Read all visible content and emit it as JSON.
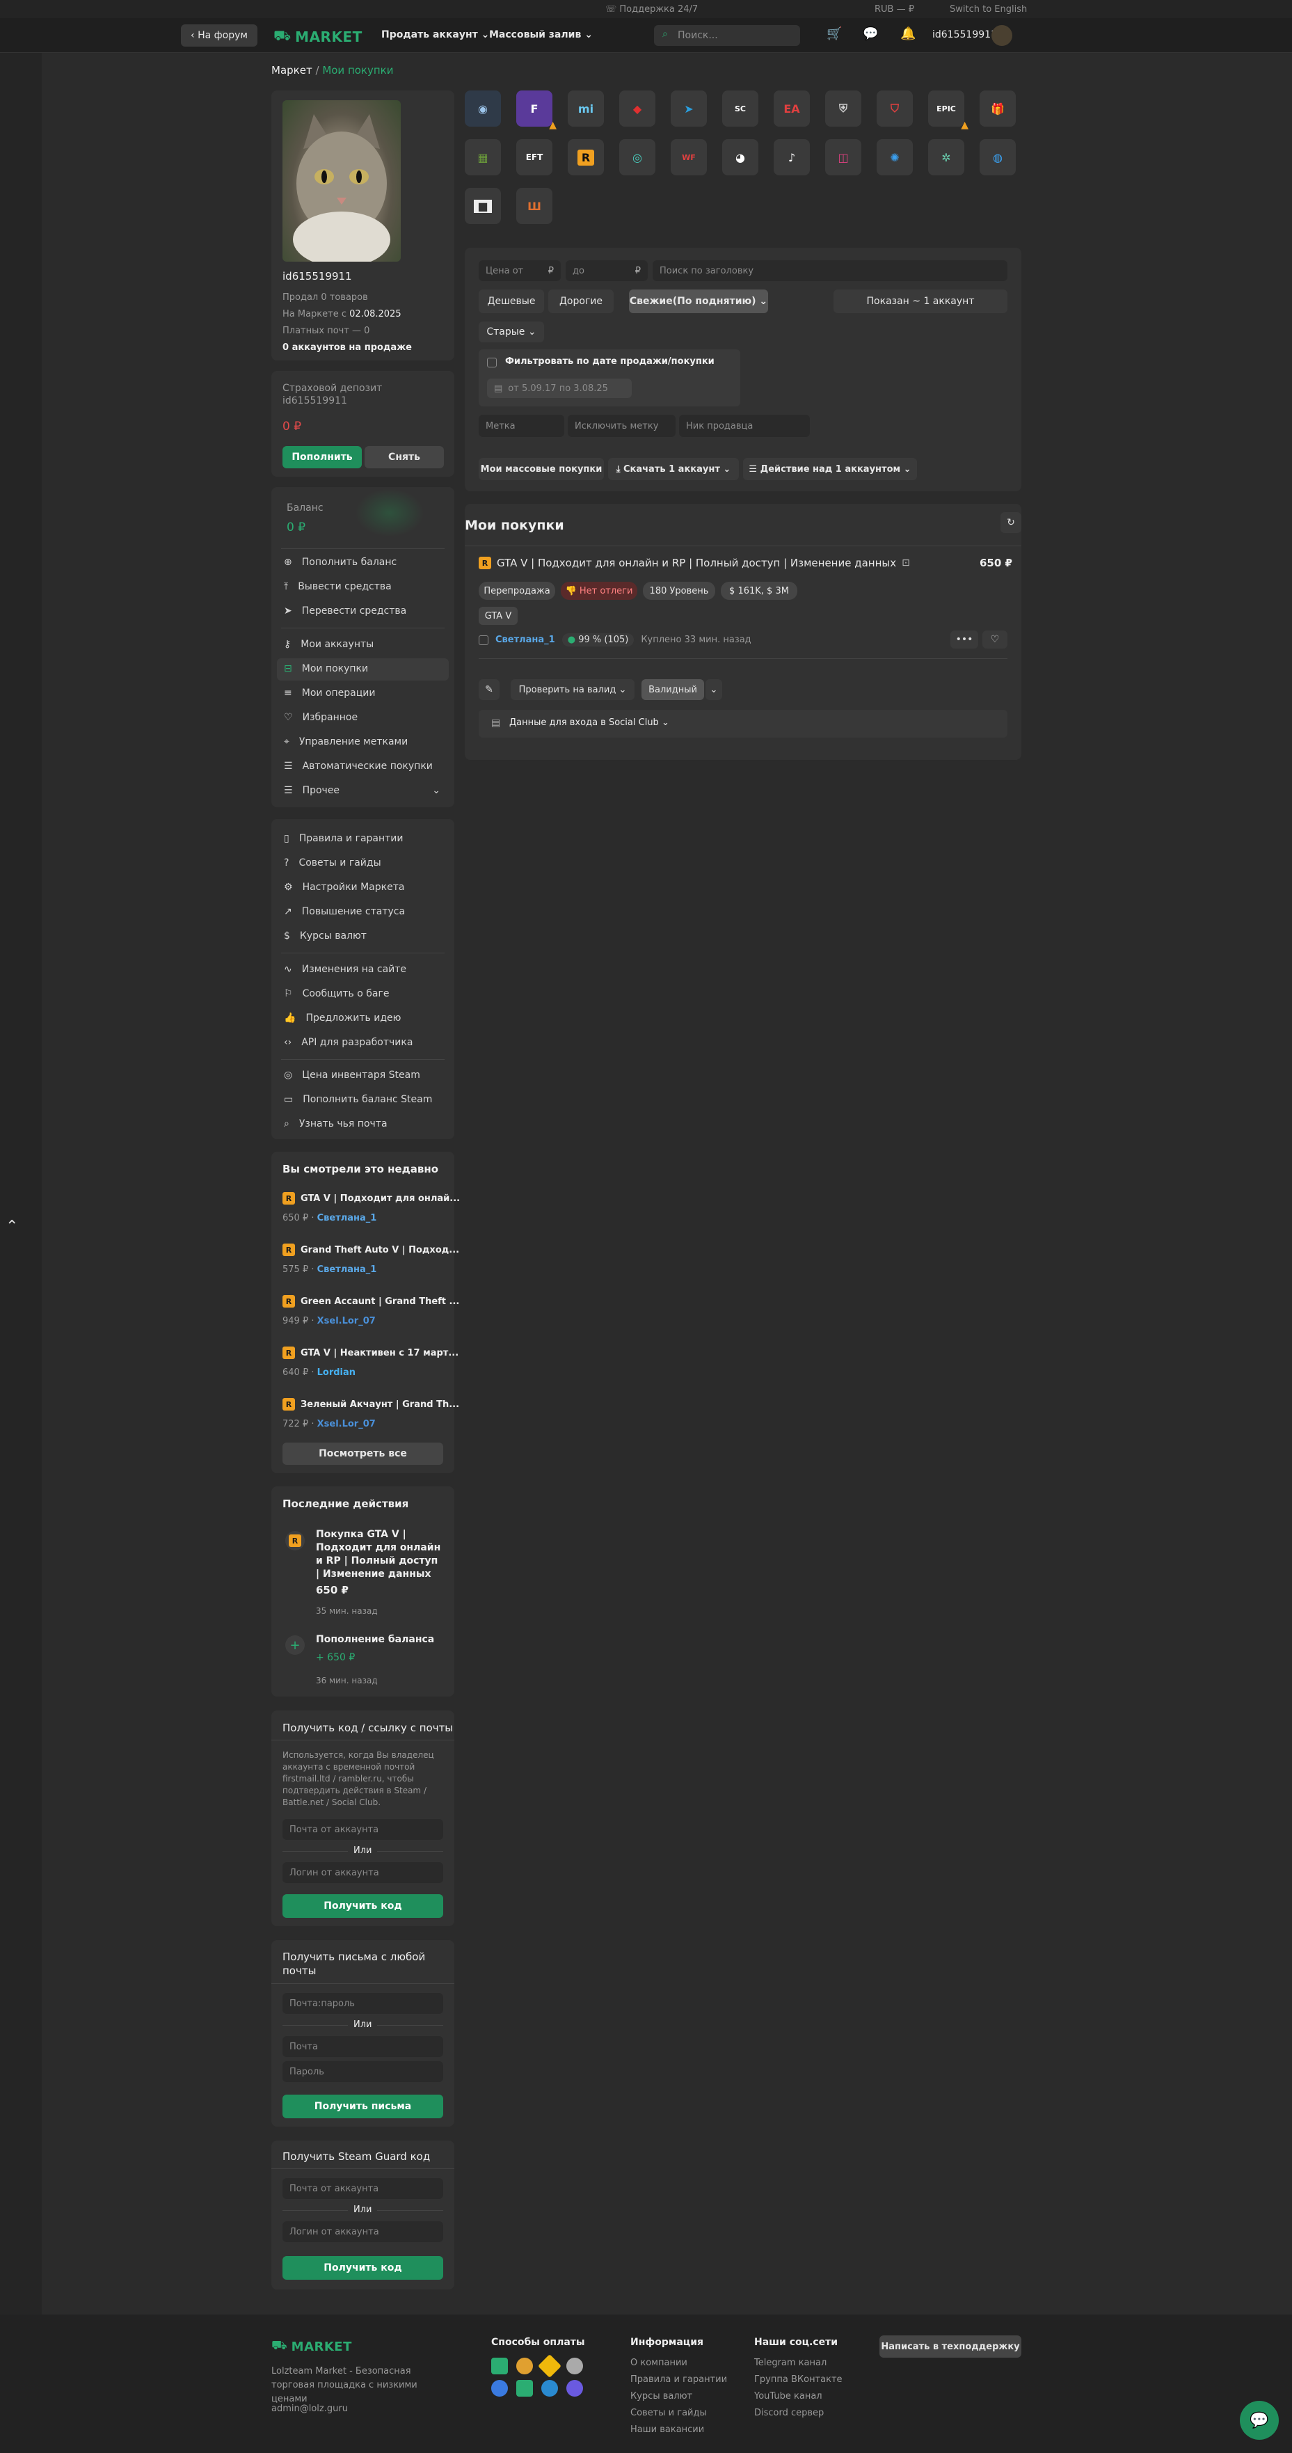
{
  "topstrip": {
    "support": "Поддержка 24/7",
    "currency": "RUB — ₽",
    "lang": "Switch to English"
  },
  "nav": {
    "back": "На форум",
    "logo": "MARKET",
    "sell": "Продать аккаунт",
    "mass": "Массовый залив",
    "search_placeholder": "Поиск...",
    "username": "id615519911"
  },
  "breadcrumb": {
    "root": "Маркет",
    "sep": "/",
    "current": "Мои покупки"
  },
  "profile": {
    "username": "id615519911",
    "sold": "Продал 0 товаров",
    "since_prefix": "На Маркете с ",
    "since_date": "02.08.2025",
    "paid_mail": "Платных почт — 0",
    "on_sale": "0 аккаунтов на продаже"
  },
  "deposit": {
    "title": "Страховой депозит id615519911",
    "amount": "0 ₽",
    "topup": "Пополнить",
    "withdraw": "Снять"
  },
  "balance": {
    "label": "Баланс",
    "amount": "0 ₽"
  },
  "menu1": [
    "Пополнить баланс",
    "Вывести средства",
    "Перевести средства"
  ],
  "menu2": [
    "Мои аккаунты",
    "Мои покупки",
    "Мои операции",
    "Избранное",
    "Управление метками",
    "Автоматические покупки",
    "Прочее"
  ],
  "menu3": [
    "Правила и гарантии",
    "Советы и гайды",
    "Настройки Маркета",
    "Повышение статуса",
    "Курсы валют"
  ],
  "menu4": [
    "Изменения на сайте",
    "Сообщить о баге",
    "Предложить идею",
    "API для разработчика"
  ],
  "menu5": [
    "Цена инвентаря Steam",
    "Пополнить баланс Steam",
    "Узнать чья почта"
  ],
  "recent": {
    "title": "Вы смотрели это недавно",
    "items": [
      {
        "title": "GTA V | Подходит для онлай...",
        "price": "650 ₽",
        "seller": "Светлана_1",
        "color": "#5aa8e8"
      },
      {
        "title": "Grand Theft Auto V | Подход...",
        "price": "575 ₽",
        "seller": "Светлана_1",
        "color": "#5aa8e8"
      },
      {
        "title": "Green Accaunt | Grand Theft ...",
        "price": "949 ₽",
        "seller": "Xsel.Lor_07",
        "color": "#4a90d9"
      },
      {
        "title": "GTA V | Неактивен с 17 март...",
        "price": "640 ₽",
        "seller": "Lordian",
        "color": "#46b0f0"
      },
      {
        "title": "Зеленый Акчаунт | Grand Th...",
        "price": "722 ₽",
        "seller": "Xsel.Lor_07",
        "color": "#4a90d9"
      }
    ],
    "view_all": "Посмотреть все"
  },
  "actions": {
    "title": "Последние действия",
    "items": [
      {
        "title": "Покупка GTA V | Подходит для онлайн и RP | Полный доступ | Изменение данных",
        "amount": "650 ₽",
        "time": "35 мин. назад"
      },
      {
        "title": "Пополнение баланса",
        "amount": "+ 650 ₽",
        "time": "36 мин. назад"
      }
    ]
  },
  "mailcode": {
    "title": "Получить код / ссылку с почты",
    "desc": "Используется, когда Вы владелец аккаунта с временной почтой firstmail.ltd / rambler.ru, чтобы подтвердить действия в Steam / Battle.net / Social Club.",
    "mail_placeholder": "Почта от аккаунта",
    "or": "Или",
    "login_placeholder": "Логин от аккаунта",
    "button": "Получить код"
  },
  "anymail": {
    "title": "Получить письма с любой почты",
    "combo_placeholder": "Почта:пароль",
    "or": "Или",
    "mail_placeholder": "Почта",
    "pass_placeholder": "Пароль",
    "button": "Получить письма"
  },
  "steamguard": {
    "title": "Получить Steam Guard код",
    "mail_placeholder": "Почта от аккаунта",
    "or": "Или",
    "login_placeholder": "Логин от аккаунта",
    "button": "Получить код"
  },
  "filters": {
    "price_from": "Цена от",
    "price_to": "до",
    "currency": "₽",
    "title_search": "Поиск по заголовку",
    "sort_cheap": "Дешевые",
    "sort_expensive": "Дорогие",
    "sort_fresh": "Свежие(По поднятию)",
    "sort_old": "Старые",
    "shown": "Показан ~ 1 аккаунт",
    "date_filter": "Фильтровать по дате продажи/покупки",
    "date_range": "от 5.09.17 по 3.08.25",
    "tag": "Метка",
    "exclude_tag": "Исключить метку",
    "seller_nick": "Ник продавца",
    "mass_buys": "Мои массовые покупки",
    "download": "Скачать 1 аккаунт",
    "action": "Действие над 1 аккаунтом"
  },
  "purchases": {
    "title": "Мои покупки",
    "item": {
      "title": "GTA V | Подходит для онлайн и RP | Полный доступ | Изменение данных",
      "price": "650 ₽",
      "tags": [
        "Перепродажа",
        "Нет отлеги",
        "180 Уровень",
        "$ 161K, $ 3M"
      ],
      "game": "GTA V",
      "seller": "Светлана_1",
      "rating": "99 % (105)",
      "bought": "Куплено 33 мин. назад",
      "check": "Проверить на валид",
      "valid": "Валидный",
      "login_data": "Данные для входа в Social Club"
    }
  },
  "footer": {
    "logo": "MARKET",
    "desc": "Lolzteam Market - Безопасная торговая площадка с низкими ценами",
    "email": "admin@lolz.guru",
    "pay_title": "Способы оплаты",
    "info_title": "Информация",
    "info": [
      "О компании",
      "Правила и гарантии",
      "Курсы валют",
      "Советы и гайды",
      "Наши вакансии"
    ],
    "social_title": "Наши соц.сети",
    "social": [
      "Telegram канал",
      "Группа ВКонтакте",
      "YouTube канал",
      "Discord сервер"
    ],
    "support_btn": "Написать в техподдержку"
  },
  "colors": {
    "accent": "#2bad72",
    "danger": "#e34a4a",
    "link": "#5aa8e8"
  }
}
